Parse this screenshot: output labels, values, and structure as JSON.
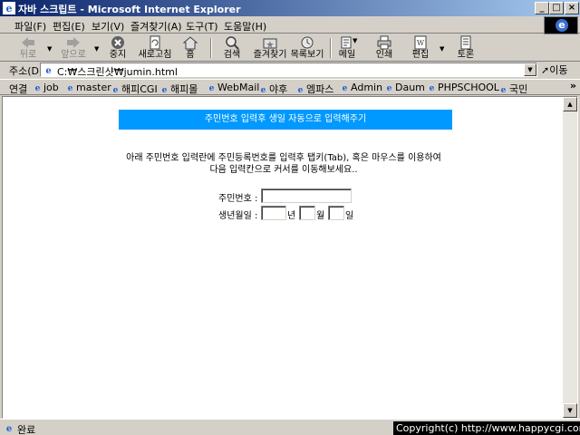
{
  "window": {
    "title": "자바 스크립트 - Microsoft Internet Explorer",
    "min": "_",
    "max": "□",
    "close": "×"
  },
  "menu": [
    "파일(F)",
    "편집(E)",
    "보기(V)",
    "즐겨찾기(A)",
    "도구(T)",
    "도움말(H)"
  ],
  "toolbar": {
    "back": "뒤로",
    "forward": "앞으로",
    "stop": "중지",
    "refresh": "새로고침",
    "home": "홈",
    "search": "검색",
    "favorites": "즐겨찾기",
    "history": "목록보기",
    "mail": "메일",
    "print": "인쇄",
    "edit": "편집",
    "discuss": "토론"
  },
  "address": {
    "label": "주소(D)",
    "value": "C:₩스크린샷₩jumin.html",
    "go": "이동"
  },
  "links": {
    "label": "연결",
    "items": [
      "job",
      "master",
      "해피CGI",
      "해피몰",
      "WebMail",
      "야후",
      "엠파스",
      "Admin",
      "Daum",
      "PHPSCHOOL",
      "국민"
    ],
    "more": "»"
  },
  "page": {
    "banner": "주민번호 입력후 생일 자동으로 입력해주기",
    "instruction_line1": "아래 주민번호 입력란에 주민등록번호를 입력후 탭키(Tab), 혹은 마우스를 이용하여",
    "instruction_line2": "다음 입력칸으로 커서를 이동해보세요..",
    "jumin_label": "주민번호 :",
    "jumin_value": "",
    "birth_label": "생년월일 :",
    "year_value": "",
    "year_unit": "년",
    "month_value": "",
    "month_unit": "월",
    "day_value": "",
    "day_unit": "일"
  },
  "status": {
    "text": "완료"
  },
  "watermark": "Copyright(c) http://www.happycgi.com"
}
